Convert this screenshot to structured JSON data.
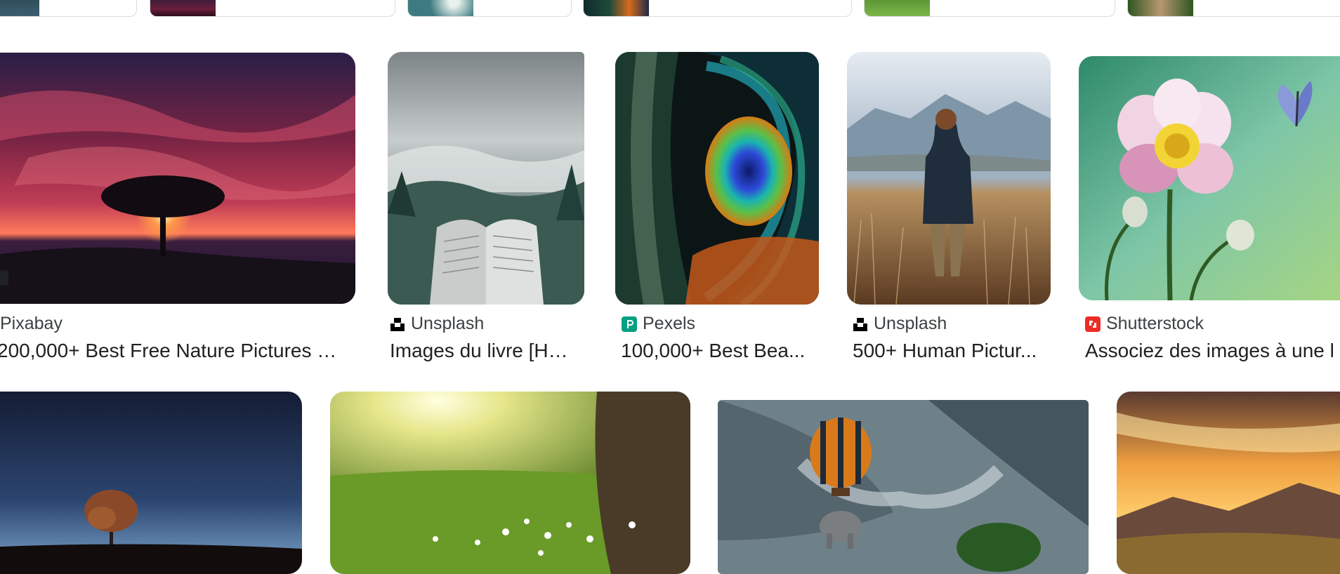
{
  "related_chips": [
    {
      "name": "chip-1"
    },
    {
      "name": "chip-2"
    },
    {
      "name": "chip-3"
    },
    {
      "name": "chip-4"
    },
    {
      "name": "chip-5"
    },
    {
      "name": "chip-6"
    }
  ],
  "results_row1": [
    {
      "source": "Pixabay",
      "title": "200,000+ Best Free Nature Pictures & ..."
    },
    {
      "source": "Unsplash",
      "title": "Images du livre [HQ..."
    },
    {
      "source": "Pexels",
      "title": "100,000+ Best Bea..."
    },
    {
      "source": "Unsplash",
      "title": "500+ Human Pictur..."
    },
    {
      "source": "Shutterstock",
      "title": "Associez des images à une l"
    }
  ],
  "favicon_colors": {
    "unsplash": "#000000",
    "pexels": "#05a081",
    "shutterstock": "#ee2b24"
  }
}
